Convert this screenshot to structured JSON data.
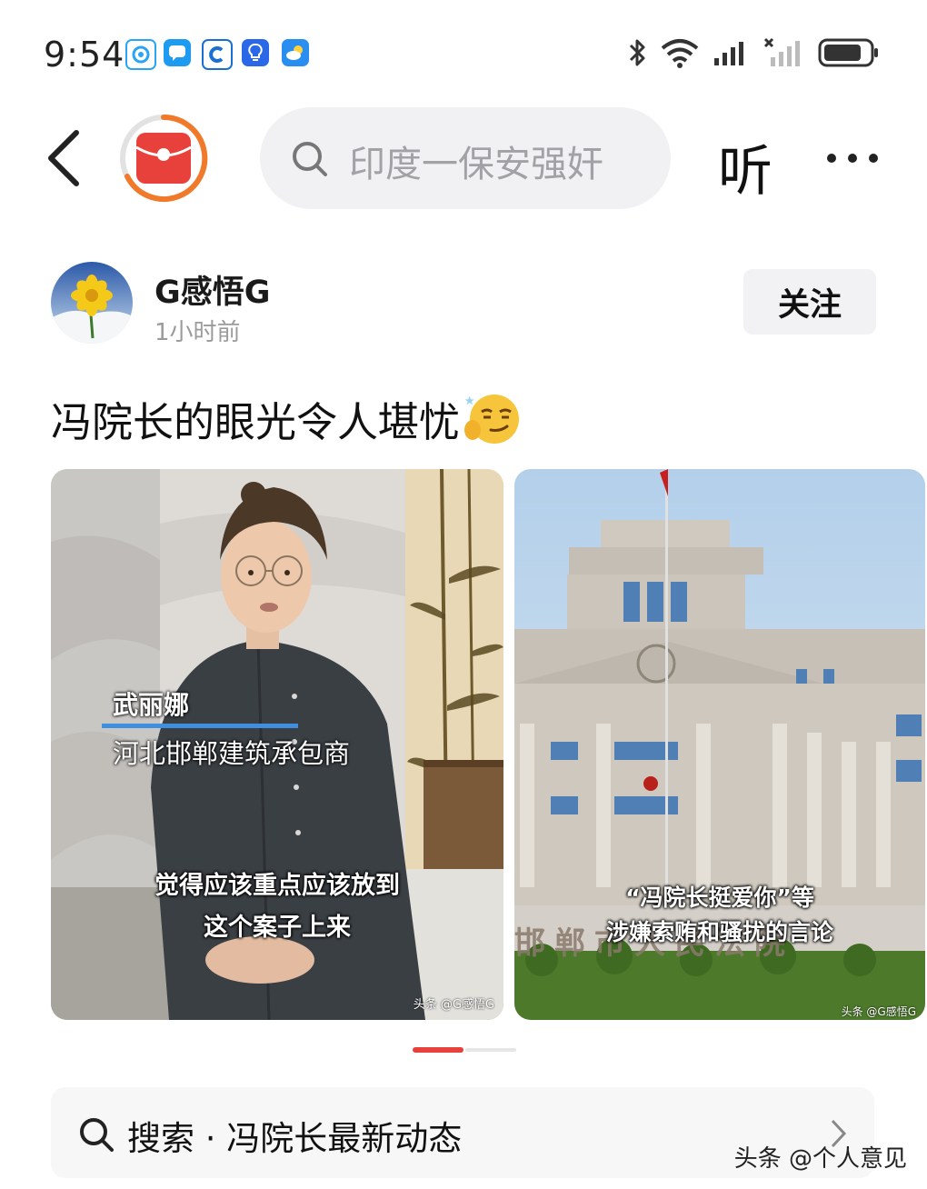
{
  "status_bar": {
    "time": "9:54"
  },
  "top_bar": {
    "search_placeholder": "印度一保安强奸",
    "listen_label": "听"
  },
  "author": {
    "name": "G感悟G",
    "time": "1小时前",
    "follow_label": "关注"
  },
  "post": {
    "title": "冯院长的眼光令人堪忧"
  },
  "images": [
    {
      "name_caption": "武丽娜",
      "role_caption": "河北邯郸建筑承包商",
      "subtitle_line1": "觉得应该重点应该放到",
      "subtitle_line2": "这个案子上来",
      "watermark": "头条 @G感悟G"
    },
    {
      "building_sign": "邯郸市人民法院",
      "subtitle_line1": "“冯院长挺爱你”等",
      "subtitle_line2": "涉嫌索贿和骚扰的言论",
      "watermark": "头条 @G感悟G"
    }
  ],
  "related_search": {
    "text": "搜索 · 冯院长最新动态"
  },
  "watermark": "头条 @个人意见",
  "colors": {
    "accent_red": "#e8403a",
    "ring_orange": "#f07a2a",
    "pill_bg": "#f1f1f3",
    "muted_text": "#9b9b9b"
  }
}
